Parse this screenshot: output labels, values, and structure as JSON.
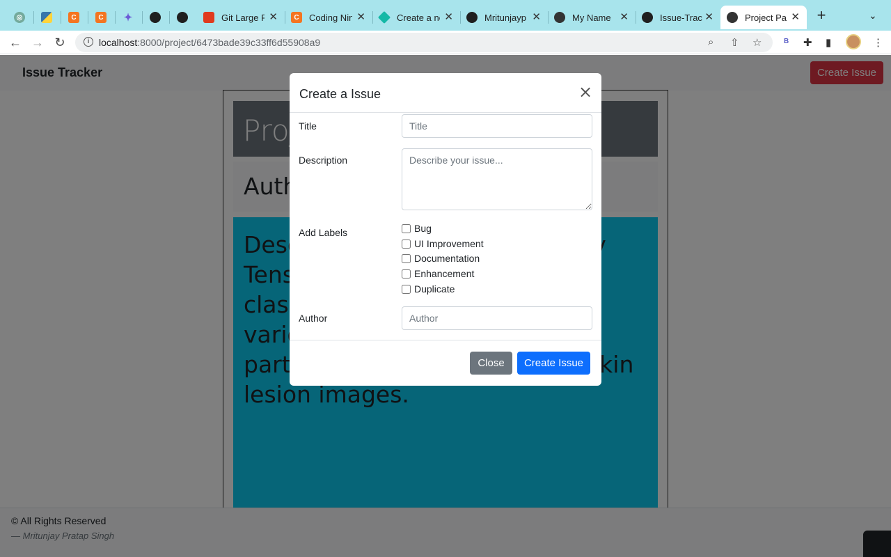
{
  "browser": {
    "tabs": [
      {
        "label": "",
        "icon": "chatgpt-icon"
      },
      {
        "label": "",
        "icon": "python-icon"
      },
      {
        "label": "",
        "icon": "codingninjas-icon"
      },
      {
        "label": "",
        "icon": "codingninjas-icon"
      },
      {
        "label": "",
        "icon": "gemini-sparkle-icon"
      },
      {
        "label": "",
        "icon": "github-icon"
      },
      {
        "label": "",
        "icon": "github-icon"
      },
      {
        "label": "Git Large F",
        "icon": "git-lfs-icon"
      },
      {
        "label": "Coding Nin",
        "icon": "codingninjas-icon"
      },
      {
        "label": "Create a ne",
        "icon": "diamond-icon"
      },
      {
        "label": "Mritunjayp",
        "icon": "github-icon"
      },
      {
        "label": "My Name",
        "icon": "globe-icon"
      },
      {
        "label": "Issue-Trac",
        "icon": "github-icon"
      },
      {
        "label": "Project Pag",
        "icon": "globe-icon",
        "active": true
      }
    ],
    "url_host": "localhost",
    "url_rest": ":8000/project/6473bade39c33ff6d55908a9",
    "extension_label": "B"
  },
  "navbar": {
    "brand": "Issue Tracker",
    "create_button": "Create Issue"
  },
  "project": {
    "title_partial": "Proj",
    "author_partial": "Auth",
    "description_partial": "Desc                                     itory focu                                       n using                                        ral Netv Tens building a multi-class classification model to identify various types of skin cancer, particularly melanoma, using skin lesion images."
  },
  "modal": {
    "title": "Create a Issue",
    "close_glyph": "×",
    "fields": {
      "title_label": "Title",
      "title_placeholder": "Title",
      "description_label": "Description",
      "description_placeholder": "Describe your issue...",
      "labels_label": "Add Labels",
      "author_label": "Author",
      "author_placeholder": "Author"
    },
    "labels": [
      "Bug",
      "UI Improvement",
      "Documentation",
      "Enhancement",
      "Duplicate"
    ],
    "close_button": "Close",
    "create_button": "Create Issue"
  },
  "footer": {
    "copyright": "© All Rights Reserved",
    "signature": "— Mritunjay Pratap Singh"
  },
  "colors": {
    "accent_blue": "#0d6efd",
    "danger_red": "#dc3545",
    "secondary_gray": "#6c757d",
    "info_cyan": "#0dcaf0",
    "tabbar": "#a8e4ec"
  }
}
